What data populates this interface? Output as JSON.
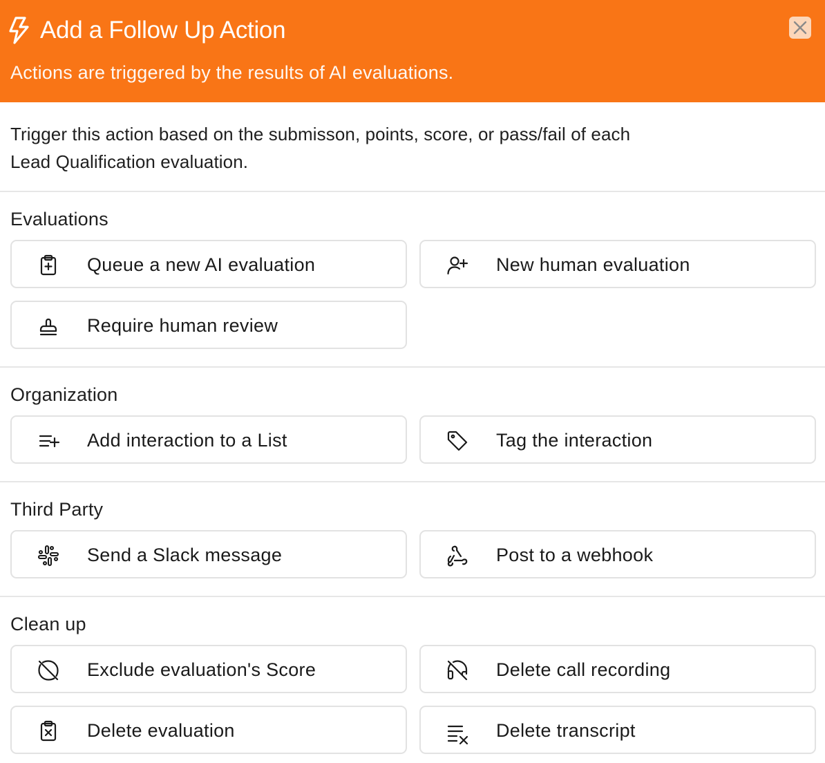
{
  "header": {
    "title": "Add a Follow Up Action",
    "subtitle": "Actions are triggered by the results of AI evaluations.",
    "icon": "lightning-bolt-icon",
    "close_icon": "close-icon",
    "color": "#f97516"
  },
  "intro": "Trigger this action based on the submisson, points, score, or pass/fail of each Lead Qualification evaluation.",
  "sections": {
    "evaluations": {
      "title": "Evaluations",
      "actions": [
        {
          "label": "Queue a new AI evaluation",
          "icon": "clipboard-plus-icon"
        },
        {
          "label": "New human evaluation",
          "icon": "user-plus-icon"
        },
        {
          "label": "Require human review",
          "icon": "stamp-icon"
        }
      ]
    },
    "organization": {
      "title": "Organization",
      "actions": [
        {
          "label": "Add interaction to a List",
          "icon": "list-plus-icon"
        },
        {
          "label": "Tag the interaction",
          "icon": "tag-icon"
        }
      ]
    },
    "third_party": {
      "title": "Third Party",
      "actions": [
        {
          "label": "Send a Slack message",
          "icon": "slack-icon"
        },
        {
          "label": "Post to a webhook",
          "icon": "webhook-icon"
        }
      ]
    },
    "clean_up": {
      "title": "Clean up",
      "actions": [
        {
          "label": "Exclude evaluation's Score",
          "icon": "circle-slash-icon"
        },
        {
          "label": "Delete call recording",
          "icon": "headphones-off-icon"
        },
        {
          "label": "Delete evaluation",
          "icon": "clipboard-x-icon"
        },
        {
          "label": "Delete transcript",
          "icon": "list-x-icon"
        }
      ]
    }
  }
}
